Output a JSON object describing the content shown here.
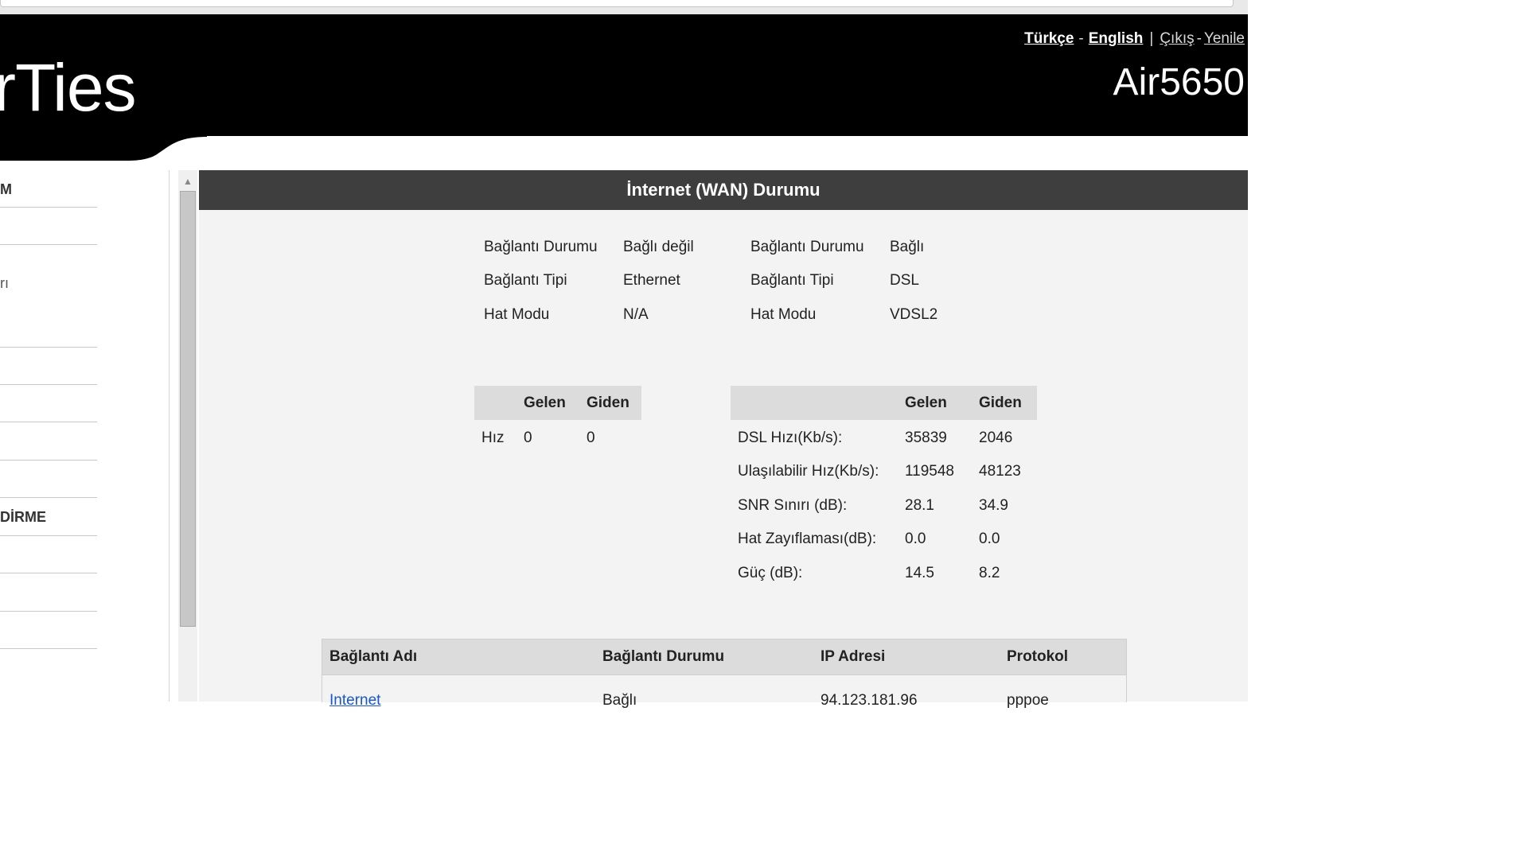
{
  "header": {
    "logo_text": "rTies",
    "model": "Air5650",
    "links": {
      "turkce": "Türkçe",
      "english": "English",
      "logout": "Çıkış",
      "refresh": "Yenile"
    },
    "separators": {
      "dash": "-",
      "pipe": "|"
    }
  },
  "sidebar": {
    "items": [
      {
        "label": "M"
      },
      {
        "label": ""
      },
      {
        "label": "rı"
      },
      {
        "label": ""
      },
      {
        "label": ""
      },
      {
        "label": ""
      },
      {
        "label": ""
      },
      {
        "label": "DİRME"
      },
      {
        "label": ""
      },
      {
        "label": ""
      },
      {
        "label": ""
      }
    ]
  },
  "main": {
    "title": "İnternet (WAN) Durumu",
    "status": {
      "left": [
        {
          "label": "Bağlantı Durumu",
          "value": "Bağlı değil"
        },
        {
          "label": "Bağlantı Tipi",
          "value": "Ethernet"
        },
        {
          "label": "Hat Modu",
          "value": "N/A"
        }
      ],
      "right": [
        {
          "label": "Bağlantı Durumu",
          "value": "Bağlı"
        },
        {
          "label": "Bağlantı Tipi",
          "value": "DSL"
        },
        {
          "label": "Hat Modu",
          "value": "VDSL2"
        }
      ]
    },
    "speed_table": {
      "headers": [
        "",
        "Gelen",
        "Giden"
      ],
      "rows": [
        {
          "label": "Hız",
          "in": "0",
          "out": "0"
        }
      ]
    },
    "dsl_table": {
      "headers": [
        "",
        "Gelen",
        "Giden"
      ],
      "rows": [
        {
          "label": "DSL Hızı(Kb/s):",
          "in": "35839",
          "out": "2046"
        },
        {
          "label": "Ulaşılabilir Hız(Kb/s):",
          "in": "119548",
          "out": "48123"
        },
        {
          "label": "SNR Sınırı (dB):",
          "in": "28.1",
          "out": "34.9"
        },
        {
          "label": "Hat Zayıflaması(dB):",
          "in": "0.0",
          "out": "0.0"
        },
        {
          "label": "Güç (dB):",
          "in": "14.5",
          "out": "8.2"
        }
      ]
    },
    "connections_table": {
      "headers": [
        "Bağlantı Adı",
        "Bağlantı Durumu",
        "IP Adresi",
        "Protokol"
      ],
      "rows": [
        {
          "name": "Internet",
          "status": "Bağlı",
          "ip": "94.123.181.96",
          "protocol": "pppoe"
        }
      ]
    }
  },
  "colors": {
    "header_bg": "#000000",
    "titlebar_bg": "#3e3e3e",
    "content_bg": "#f3f3f3",
    "table_header_bg": "#dcdcdc",
    "link": "#1a56c8"
  }
}
